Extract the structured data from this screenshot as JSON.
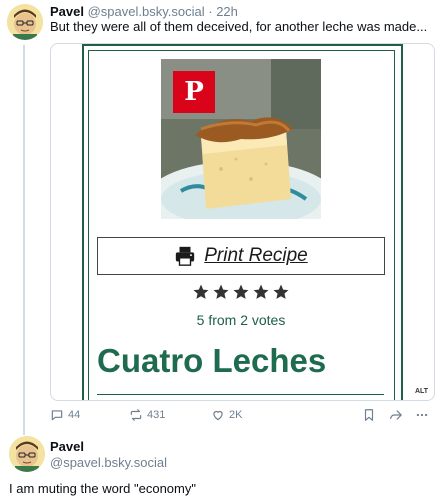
{
  "post": {
    "author_name": "Pavel",
    "author_handle": "@spavel.bsky.social",
    "time_sep": "·",
    "time_ago": "22h",
    "text": "But they were all of them deceived, for another leche was made...",
    "embed": {
      "print_label": "Print Recipe",
      "rating": 5,
      "votes_text": "5 from 2 votes",
      "recipe_title": "Cuatro Leches",
      "alt_badge": "ALT"
    },
    "actions": {
      "replies": "44",
      "reposts": "431",
      "likes": "2K"
    }
  },
  "reply": {
    "author_name": "Pavel",
    "author_handle": "@spavel.bsky.social",
    "text": "I am muting the word \"economy\""
  },
  "icons": [
    "avatar",
    "pinterest-icon",
    "printer-icon",
    "star-icon",
    "reply-icon",
    "repost-icon",
    "like-icon",
    "bookmark-icon",
    "share-icon",
    "more-icon"
  ],
  "colors": {
    "brand_green": "#1f6b4f",
    "pinterest_red": "#d9041a",
    "muted_text": "#6f7f8f"
  }
}
